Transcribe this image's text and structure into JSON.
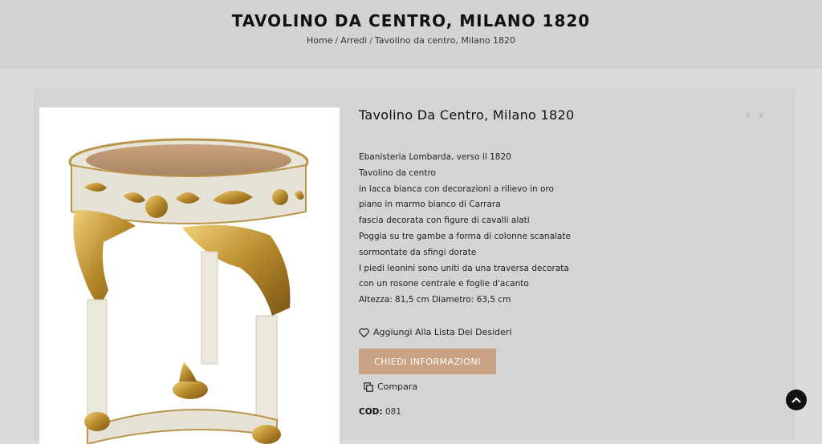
{
  "header": {
    "title": "TAVOLINO DA CENTRO, MILANO 1820",
    "breadcrumb": [
      "Home",
      "Arredi",
      "Tavolino da centro, Milano 1820"
    ]
  },
  "product": {
    "name": "Tavolino Da Centro, Milano 1820",
    "image_alt_icon": "gilded-table-image",
    "description": [
      "Ebanisteria Lombarda, verso il 1820",
      "Tavolino da centro",
      "in lacca bianca con decorazioni a rilievo in oro",
      "piano in marmo bianco di Carrara",
      "fascia decorata con figure di cavalli alati",
      "Poggia su tre gambe a forma di colonne scanalate",
      "sormontate da sfingi dorate",
      "I piedi leonini sono uniti da una traversa decorata",
      "con un rosone centrale e foglie d'acanto",
      "Altezza: 81,5 cm Diametro: 63,5 cm"
    ],
    "wishlist_label": "Aggiungi Alla Lista Dei Desideri",
    "info_button_label": "CHIEDI INFORMAZIONI",
    "compare_label": "Compara",
    "cod_label": "COD:",
    "cod_value": "081"
  },
  "nav": {
    "prev_icon": "chevron-left-icon",
    "next_icon": "chevron-right-icon"
  },
  "colors": {
    "accent": "#c9a283",
    "background": "#dddcdb",
    "header_bg": "#d4d3d2"
  }
}
